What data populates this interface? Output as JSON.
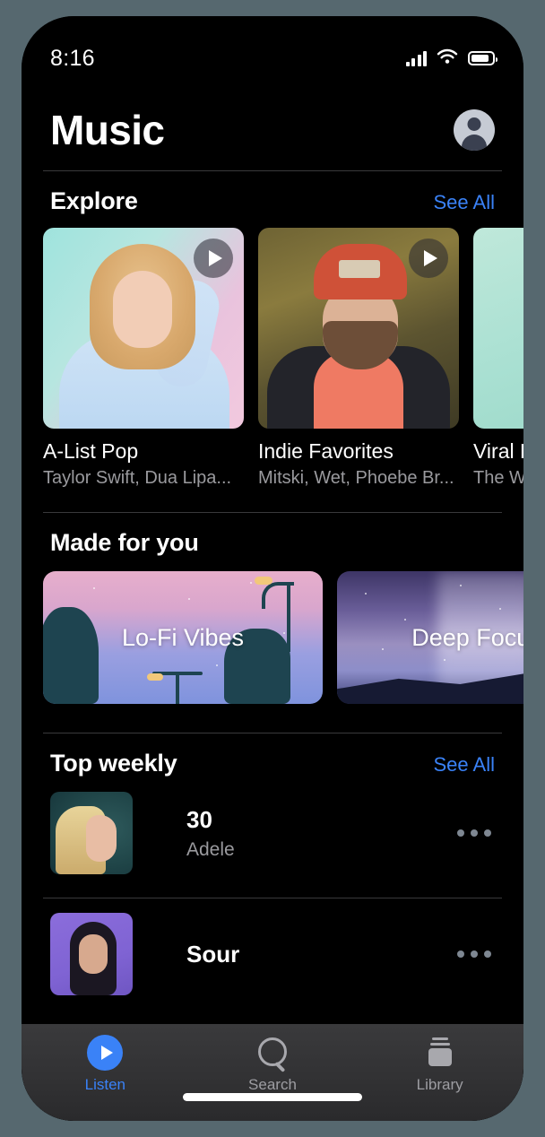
{
  "status_bar": {
    "time": "8:16",
    "signal_icon": "cellular-signal-icon",
    "wifi_icon": "wifi-icon",
    "battery_icon": "battery-icon"
  },
  "header": {
    "title": "Music",
    "avatar_icon": "account-avatar-icon"
  },
  "sections": {
    "explore": {
      "title": "Explore",
      "see_all": "See All",
      "cards": [
        {
          "title": "A-List Pop",
          "subtitle": "Taylor Swift, Dua Lipa...",
          "play_icon": "play-icon"
        },
        {
          "title": "Indie Favorites",
          "subtitle": "Mitski, Wet, Phoebe Br...",
          "play_icon": "play-icon"
        },
        {
          "title": "Viral H",
          "subtitle": "The W",
          "play_icon": "play-icon"
        }
      ]
    },
    "made_for_you": {
      "title": "Made for you",
      "cards": [
        {
          "label": "Lo-Fi Vibes"
        },
        {
          "label": "Deep Focus"
        }
      ]
    },
    "top_weekly": {
      "title": "Top weekly",
      "see_all": "See All",
      "tracks": [
        {
          "title": "30",
          "artist": "Adele",
          "more_icon": "more-options-icon"
        },
        {
          "title": "Sour",
          "artist": "",
          "more_icon": "more-options-icon"
        }
      ]
    }
  },
  "tab_bar": {
    "tabs": [
      {
        "label": "Listen",
        "icon": "play-circle-icon",
        "active": true
      },
      {
        "label": "Search",
        "icon": "search-icon",
        "active": false
      },
      {
        "label": "Library",
        "icon": "library-icon",
        "active": false
      }
    ]
  },
  "colors": {
    "accent": "#3a82f7",
    "background": "#000000",
    "page_backdrop": "#56686f",
    "secondary_text": "#9a9a9e"
  }
}
